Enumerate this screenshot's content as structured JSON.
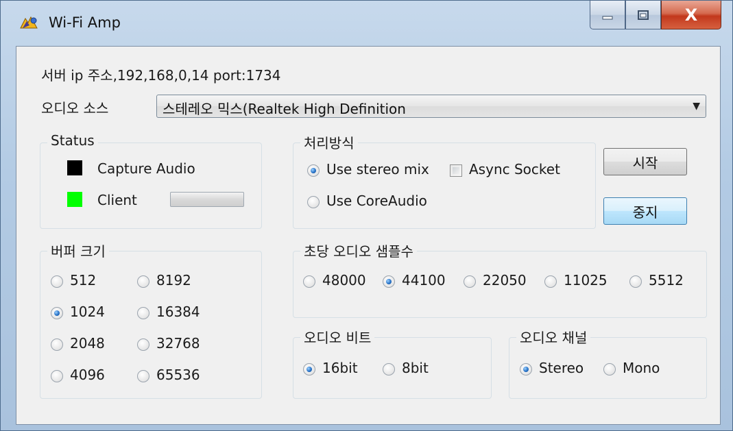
{
  "window": {
    "title": "Wi-Fi Amp",
    "app_icon": "wifi-amp-icon"
  },
  "caption": {
    "minimize": "minimize-icon",
    "maximize": "maximize-icon",
    "close": "close-icon",
    "close_glyph": "X"
  },
  "server_info": "서버 ip 주소,192,168,0,14 port:1734",
  "audio_source": {
    "label": "오디오 소스",
    "value": "스테레오 믹스(Realtek High Definition"
  },
  "status": {
    "title": "Status",
    "capture_label": "Capture  Audio",
    "capture_color": "#000000",
    "client_label": "Client",
    "client_color": "#00ff00"
  },
  "processing": {
    "title": "처리방식",
    "options": [
      {
        "label": "Use stereo mix",
        "checked": true
      },
      {
        "label": "Use CoreAudio",
        "checked": false
      }
    ],
    "async_socket": {
      "label": "Async Socket",
      "checked": false
    }
  },
  "buttons": {
    "start": "시작",
    "stop": "중지"
  },
  "buffer_size": {
    "title": "버퍼 크기",
    "options": [
      {
        "label": "512",
        "checked": false
      },
      {
        "label": "8192",
        "checked": false
      },
      {
        "label": "1024",
        "checked": true
      },
      {
        "label": "16384",
        "checked": false
      },
      {
        "label": "2048",
        "checked": false
      },
      {
        "label": "32768",
        "checked": false
      },
      {
        "label": "4096",
        "checked": false
      },
      {
        "label": "65536",
        "checked": false
      }
    ]
  },
  "sample_rate": {
    "title": "초당 오디오 샘플수",
    "options": [
      {
        "label": "48000",
        "checked": false
      },
      {
        "label": "44100",
        "checked": true
      },
      {
        "label": "22050",
        "checked": false
      },
      {
        "label": "11025",
        "checked": false
      },
      {
        "label": "5512",
        "checked": false
      }
    ]
  },
  "audio_bits": {
    "title": "오디오 비트",
    "options": [
      {
        "label": "16bit",
        "checked": true
      },
      {
        "label": "8bit",
        "checked": false
      }
    ]
  },
  "audio_channel": {
    "title": "오디오 채널",
    "options": [
      {
        "label": "Stereo",
        "checked": true
      },
      {
        "label": "Mono",
        "checked": false
      }
    ]
  }
}
